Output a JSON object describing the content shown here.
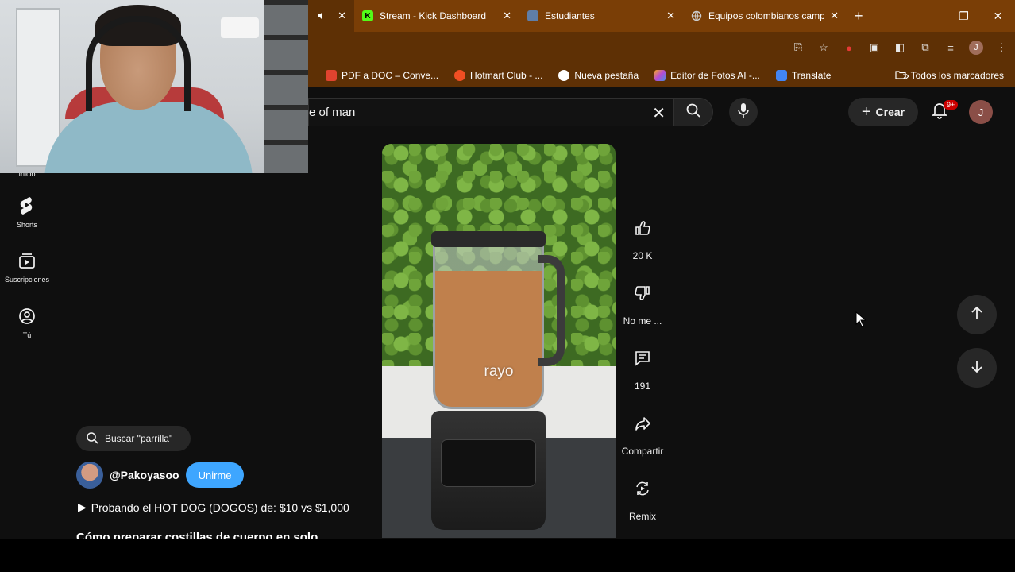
{
  "browser": {
    "tabs": [
      {
        "title": "",
        "icon": "speaker-icon",
        "active": true
      },
      {
        "title": "Stream - Kick Dashboard",
        "icon": "kick-icon",
        "color": "#53fc18"
      },
      {
        "title": "Estudiantes",
        "icon": "doc-icon",
        "color": "#5f7ea8"
      },
      {
        "title": "Equipos colombianos camp",
        "icon": "globe-icon",
        "color": "#cccccc"
      }
    ],
    "new_tab": "+",
    "bookmarks": [
      {
        "label": "PDF a DOC – Conve...",
        "color": "#e0432f"
      },
      {
        "label": "Hotmart Club - ...",
        "color": "#f04e23"
      },
      {
        "label": "Nueva pestaña",
        "color": "#ffffff"
      },
      {
        "label": "Editor de Fotos AI -...",
        "color": "#b64bd6"
      },
      {
        "label": "Translate",
        "color": "#4285f4"
      }
    ],
    "bookmarks_overflow": "»",
    "all_bookmarks": "Todos los marcadores",
    "profile_initial": "J"
  },
  "youtube": {
    "search_value": "e of man",
    "create_label": "Crear",
    "notif_badge": "9+",
    "user_initial": "J",
    "guide": [
      {
        "label": "Inicio",
        "icon": "home-icon"
      },
      {
        "label": "Shorts",
        "icon": "shorts-icon"
      },
      {
        "label": "Suscripciones",
        "icon": "subscriptions-icon"
      },
      {
        "label": "Tú",
        "icon": "you-icon"
      }
    ],
    "short": {
      "overlay_text": "rayo",
      "actions": [
        {
          "label": "20 K",
          "icon": "like-icon"
        },
        {
          "label": "No me ...",
          "icon": "dislike-icon"
        },
        {
          "label": "191",
          "icon": "comment-icon"
        },
        {
          "label": "Compartir",
          "icon": "share-icon"
        },
        {
          "label": "Remix",
          "icon": "remix-icon"
        }
      ],
      "search_chip": "Buscar \"parrilla\"",
      "channel": "@Pakoyasoo",
      "join_label": "Unirme",
      "linked_video": "Probando el HOT DOG (DOGOS) de: $10 vs $1,000",
      "description": "Cómo preparar costillas de cuerpo en solo"
    }
  }
}
